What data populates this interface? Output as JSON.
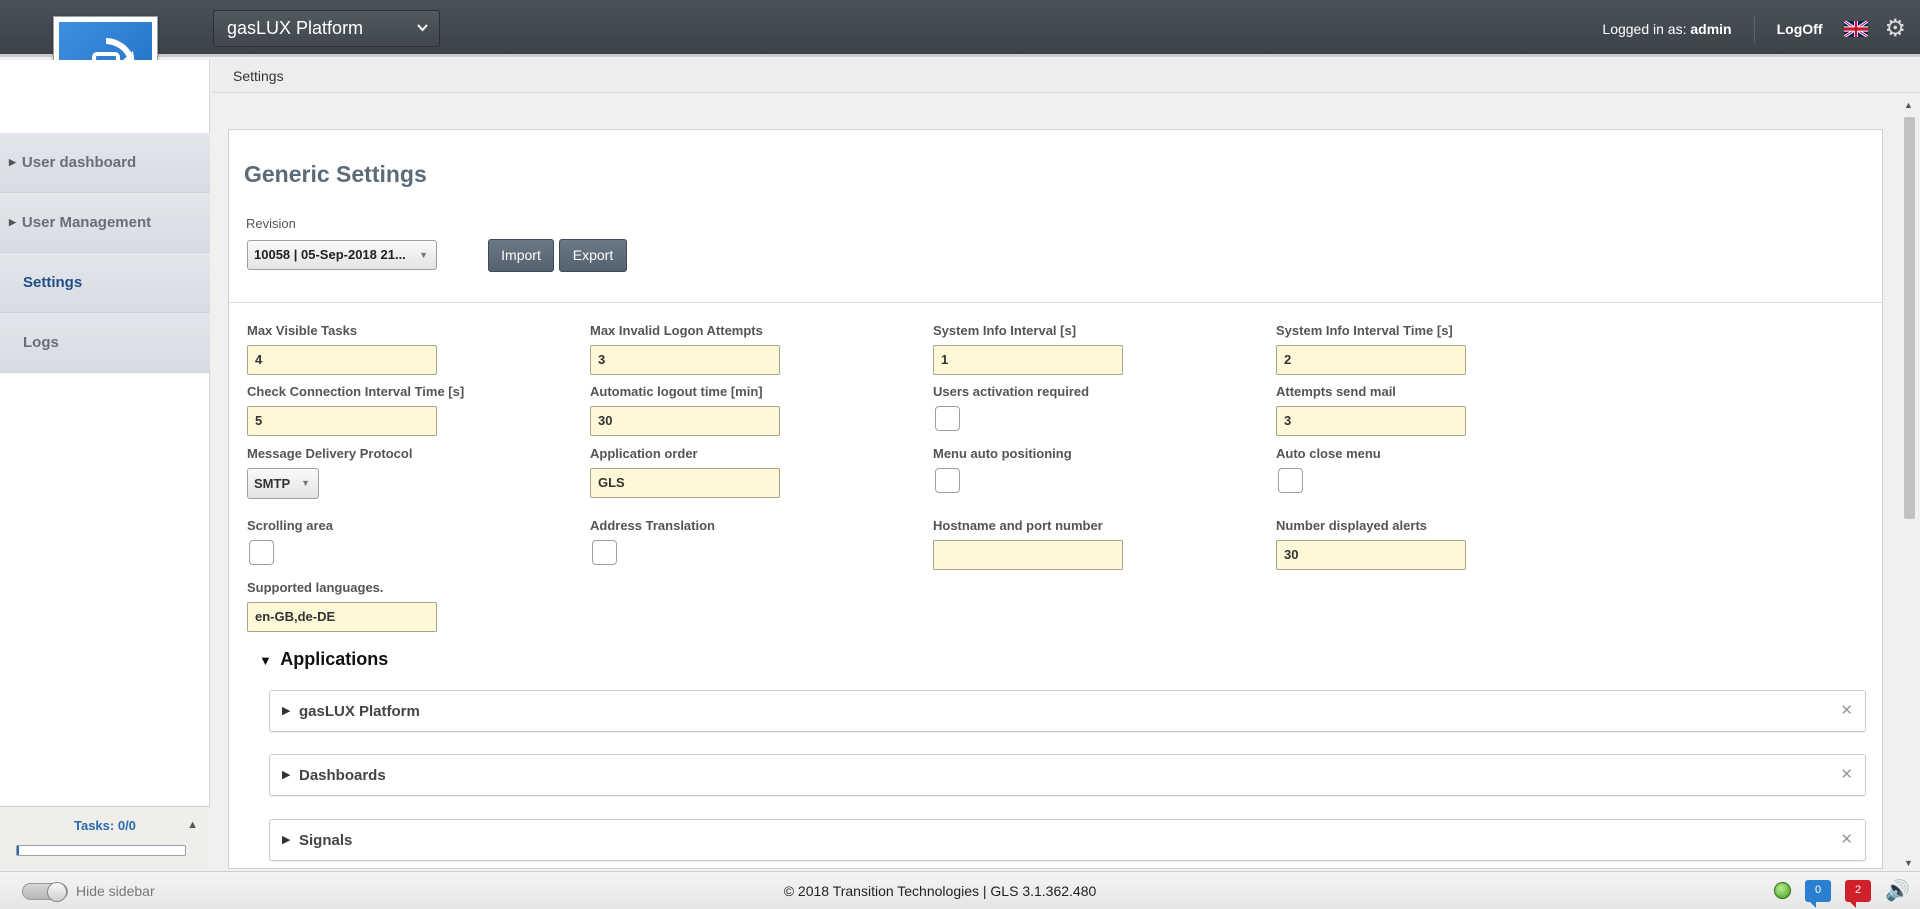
{
  "header": {
    "app_selector": "gasLUX Platform",
    "logged_in_prefix": "Logged in as:",
    "logged_in_user": "admin",
    "logoff": "LogOff",
    "language_flag": "uk-flag-icon",
    "settings_icon": "gear-icon"
  },
  "sidebar": {
    "items": [
      {
        "label": "User dashboard",
        "expandable": true
      },
      {
        "label": "User Management",
        "expandable": true
      },
      {
        "label": "Settings",
        "active": true
      },
      {
        "label": "Logs"
      }
    ],
    "tasks_label": "Tasks: 0/0",
    "tasks_progress": 0
  },
  "breadcrumb": "Settings",
  "main": {
    "title": "Generic Settings",
    "revision_label": "Revision",
    "revision_value": "10058 | 05-Sep-2018 21...",
    "import_label": "Import",
    "export_label": "Export",
    "fields": {
      "max_visible_tasks": {
        "label": "Max Visible Tasks",
        "value": "4"
      },
      "max_invalid_logon": {
        "label": "Max Invalid Logon Attempts",
        "value": "3"
      },
      "system_info_interval": {
        "label": "System Info Interval [s]",
        "value": "1"
      },
      "system_info_interval_time": {
        "label": "System Info Interval Time [s]",
        "value": "2"
      },
      "check_connection": {
        "label": "Check Connection Interval Time [s]",
        "value": "5"
      },
      "auto_logout": {
        "label": "Automatic logout time [min]",
        "value": "30"
      },
      "users_activation": {
        "label": "Users activation required",
        "checked": false
      },
      "attempts_send_mail": {
        "label": "Attempts send mail",
        "value": "3"
      },
      "message_delivery": {
        "label": "Message Delivery Protocol",
        "value": "SMTP"
      },
      "application_order": {
        "label": "Application order",
        "value": "GLS"
      },
      "menu_auto_positioning": {
        "label": "Menu auto positioning",
        "checked": false
      },
      "auto_close_menu": {
        "label": "Auto close menu",
        "checked": false
      },
      "scrolling_area": {
        "label": "Scrolling area",
        "checked": false
      },
      "address_translation": {
        "label": "Address Translation",
        "checked": false
      },
      "hostname_port": {
        "label": "Hostname and port number",
        "value": ""
      },
      "number_alerts": {
        "label": "Number displayed alerts",
        "value": "30"
      },
      "supported_languages": {
        "label": "Supported languages.",
        "value": "en-GB,de-DE"
      }
    },
    "applications_heading": "Applications",
    "applications": [
      "gasLUX Platform",
      "Dashboards",
      "Signals"
    ]
  },
  "footer": {
    "hide_sidebar": "Hide sidebar",
    "copyright": "© 2018 Transition Technologies | GLS 3.1.362.480",
    "messages_count": "0",
    "alerts_count": "2"
  },
  "colors": {
    "topbar": "#3c4248",
    "input_bg": "#fff8d8",
    "active_nav": "#1f4e85",
    "tasks_text": "#2a6bb0"
  }
}
